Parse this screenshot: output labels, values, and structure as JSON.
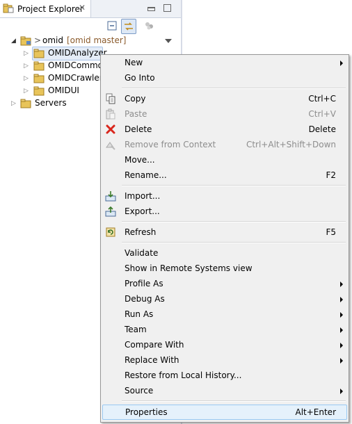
{
  "view": {
    "tab_title": "Project Explorer",
    "tab_close": "✕"
  },
  "tree": {
    "root": {
      "name": "omid",
      "prefix": ">",
      "decoration": "[omid master]"
    },
    "children": [
      {
        "name": "OMIDAnalyzer"
      },
      {
        "name": "OMIDCommo"
      },
      {
        "name": "OMIDCrawler"
      },
      {
        "name": "OMIDUI"
      }
    ],
    "servers": {
      "name": "Servers"
    }
  },
  "menu": {
    "items": [
      {
        "label": "New",
        "shortcut": "",
        "submenu": true,
        "icon": ""
      },
      {
        "label": "Go Into",
        "shortcut": "",
        "submenu": false,
        "icon": ""
      },
      {
        "label": "Copy",
        "shortcut": "Ctrl+C",
        "submenu": false,
        "icon": "copy-icon"
      },
      {
        "label": "Paste",
        "shortcut": "Ctrl+V",
        "submenu": false,
        "icon": "paste-icon",
        "disabled": true
      },
      {
        "label": "Delete",
        "shortcut": "Delete",
        "submenu": false,
        "icon": "delete-icon"
      },
      {
        "label": "Remove from Context",
        "shortcut": "Ctrl+Alt+Shift+Down",
        "submenu": false,
        "icon": "remove-context-icon",
        "disabled": true
      },
      {
        "label": "Move...",
        "shortcut": "",
        "submenu": false,
        "icon": ""
      },
      {
        "label": "Rename...",
        "shortcut": "F2",
        "submenu": false,
        "icon": ""
      },
      {
        "label": "Import...",
        "shortcut": "",
        "submenu": false,
        "icon": "import-icon"
      },
      {
        "label": "Export...",
        "shortcut": "",
        "submenu": false,
        "icon": "export-icon"
      },
      {
        "label": "Refresh",
        "shortcut": "F5",
        "submenu": false,
        "icon": "refresh-icon"
      },
      {
        "label": "Validate",
        "shortcut": "",
        "submenu": false,
        "icon": ""
      },
      {
        "label": "Show in Remote Systems view",
        "shortcut": "",
        "submenu": false,
        "icon": ""
      },
      {
        "label": "Profile As",
        "shortcut": "",
        "submenu": true,
        "icon": ""
      },
      {
        "label": "Debug As",
        "shortcut": "",
        "submenu": true,
        "icon": ""
      },
      {
        "label": "Run As",
        "shortcut": "",
        "submenu": true,
        "icon": ""
      },
      {
        "label": "Team",
        "shortcut": "",
        "submenu": true,
        "icon": ""
      },
      {
        "label": "Compare With",
        "shortcut": "",
        "submenu": true,
        "icon": ""
      },
      {
        "label": "Replace With",
        "shortcut": "",
        "submenu": true,
        "icon": ""
      },
      {
        "label": "Restore from Local History...",
        "shortcut": "",
        "submenu": false,
        "icon": ""
      },
      {
        "label": "Source",
        "shortcut": "",
        "submenu": true,
        "icon": ""
      },
      {
        "label": "Properties",
        "shortcut": "Alt+Enter",
        "submenu": false,
        "icon": "",
        "highlighted": true
      }
    ]
  },
  "colors": {
    "selection": "#e4ecf7",
    "menu_bg": "#f0f0f0",
    "hover": "#e5f1fb",
    "folder": "#e8c45a",
    "delete_red": "#d9261c"
  }
}
